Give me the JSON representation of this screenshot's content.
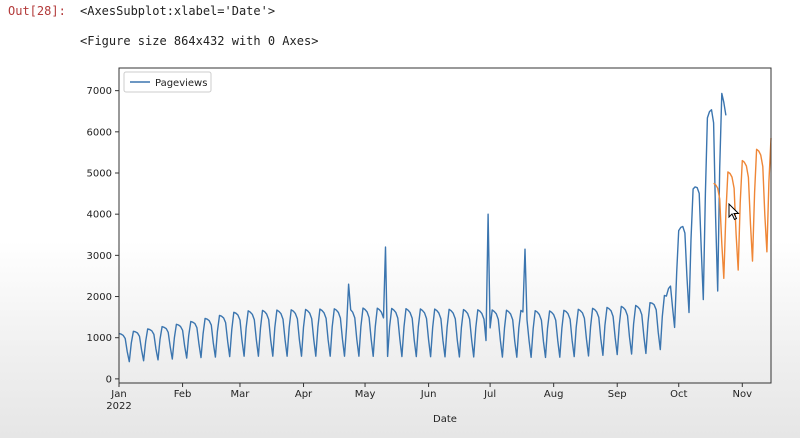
{
  "cell": {
    "prompt": "Out[28]:",
    "result_repr": "<AxesSubplot:xlabel='Date'>",
    "figure_repr": "<Figure size 864x432 with 0 Axes>"
  },
  "colors": {
    "observed": "#3b75af",
    "forecast": "#ef8636",
    "prompt": "#b33a3a"
  },
  "chart_data": {
    "type": "line",
    "xlabel": "Date",
    "ylabel": "",
    "x_ticks": [
      {
        "label": "Jan",
        "year": "2022",
        "date": "2022-01-01"
      },
      {
        "label": "Feb",
        "date": "2022-02-01"
      },
      {
        "label": "Mar",
        "date": "2022-03-01"
      },
      {
        "label": "Apr",
        "date": "2022-04-01"
      },
      {
        "label": "May",
        "date": "2022-05-01"
      },
      {
        "label": "Jun",
        "date": "2022-06-01"
      },
      {
        "label": "Jul",
        "date": "2022-07-01"
      },
      {
        "label": "Aug",
        "date": "2022-08-01"
      },
      {
        "label": "Sep",
        "date": "2022-09-01"
      },
      {
        "label": "Oct",
        "date": "2022-10-01"
      },
      {
        "label": "Nov",
        "date": "2022-11-01"
      }
    ],
    "xlim": [
      "2022-01-01",
      "2022-11-15"
    ],
    "y_ticks": [
      0,
      1000,
      2000,
      3000,
      4000,
      5000,
      6000,
      7000
    ],
    "ylim": [
      -100,
      7550
    ],
    "grid": false,
    "legend": {
      "position": "top-left",
      "entries": [
        "Pageviews"
      ]
    },
    "series": [
      {
        "name": "Pageviews",
        "color": "#3b75af",
        "date_range": [
          "2022-01-01",
          "2022-10-24"
        ],
        "weekly": {
          "anchors": [
            {
              "date": "2022-01-01",
              "peak": 1100,
              "trough": 400
            },
            {
              "date": "2022-02-01",
              "peak": 1350,
              "trough": 500
            },
            {
              "date": "2022-03-01",
              "peak": 1650,
              "trough": 550
            },
            {
              "date": "2022-05-01",
              "peak": 1720,
              "trough": 550
            },
            {
              "date": "2022-08-01",
              "peak": 1650,
              "trough": 520
            },
            {
              "date": "2022-09-15",
              "peak": 1800,
              "trough": 620
            },
            {
              "date": "2022-09-25",
              "peak": 2050,
              "trough": 750
            },
            {
              "date": "2022-10-01",
              "peak": 3600,
              "trough": 1500
            },
            {
              "date": "2022-10-10",
              "peak": 4900,
              "trough": 1700
            },
            {
              "date": "2022-10-18",
              "peak": 7200,
              "trough": 2300
            },
            {
              "date": "2022-10-24",
              "peak": 6800,
              "trough": 1800
            }
          ]
        },
        "spikes": [
          {
            "date": "2022-04-23",
            "value": 2300
          },
          {
            "date": "2022-05-11",
            "value": 3200
          },
          {
            "date": "2022-06-30",
            "value": 4000
          },
          {
            "date": "2022-07-18",
            "value": 3150
          }
        ]
      },
      {
        "name": "",
        "color": "#ef8636",
        "date_range": [
          "2022-10-18",
          "2022-11-15"
        ],
        "weekly": {
          "anchors": [
            {
              "date": "2022-10-18",
              "peak": 4750,
              "trough": 2300
            },
            {
              "date": "2022-11-01",
              "peak": 5300,
              "trough": 2700
            },
            {
              "date": "2022-11-15",
              "peak": 5850,
              "trough": 3150
            }
          ]
        },
        "spikes": []
      }
    ]
  }
}
